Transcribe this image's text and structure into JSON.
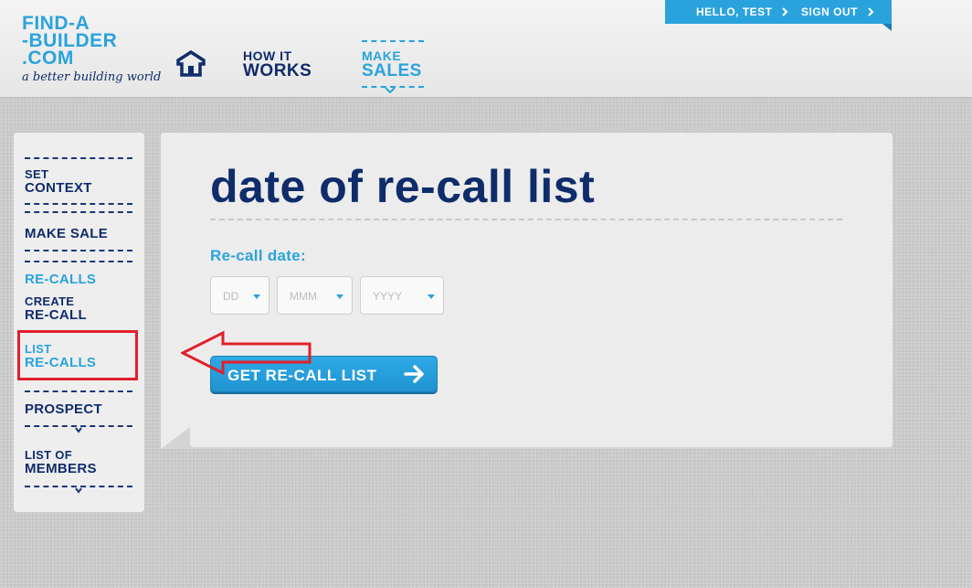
{
  "logo": {
    "line1": "FIND-A",
    "line2": "-BUILDER",
    "line3": ".COM",
    "tagline": "a better building world"
  },
  "nav": {
    "home_icon": "house-icon",
    "how_small": "HOW IT",
    "how_big": "WORKS",
    "sales_small": "MAKE",
    "sales_big": "SALES"
  },
  "user": {
    "hello": "HELLO, TEST",
    "signout": "SIGN OUT",
    "chevron_icon": "chevron-right-icon"
  },
  "sidebar": {
    "set_small": "SET",
    "set_big": "CONTEXT",
    "make_sale": "MAKE SALE",
    "recalls": "RE-CALLS",
    "create_small": "CREATE",
    "create_big": "RE-CALL",
    "list_small": "LIST",
    "list_big": "RE-CALLS",
    "prospect": "PROSPECT",
    "members_small": "LIST OF",
    "members_big": "MEMBERS"
  },
  "main": {
    "title": "date of re-call list",
    "field_label": "Re-call date:",
    "dd_placeholder": "DD",
    "mmm_placeholder": "MMM",
    "yyyy_placeholder": "YYYY",
    "button_label": "GET RE-CALL LIST",
    "button_icon": "arrow-right-icon"
  },
  "colors": {
    "navy": "#0f2c6b",
    "accent_blue": "#2aa3dd",
    "annotation_red": "#e0202b"
  }
}
